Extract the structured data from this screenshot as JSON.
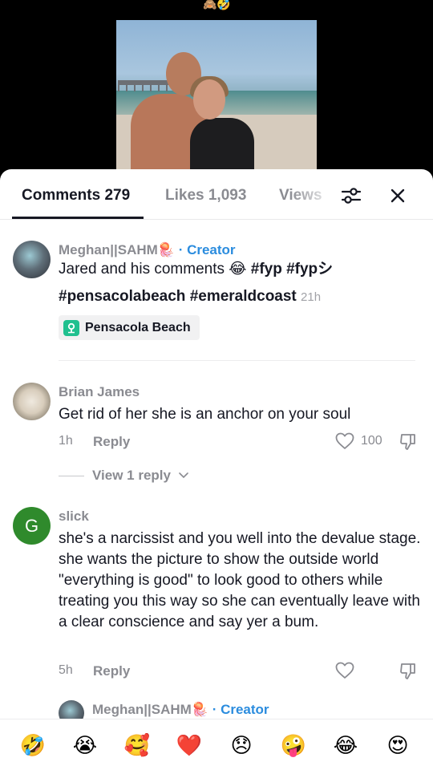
{
  "video": {
    "top_emoji": "🙈🤣"
  },
  "tabs": {
    "comments": "Comments 279",
    "likes": "Likes 1,093",
    "views": "Views"
  },
  "comments": [
    {
      "username": "Meghan||SAHM🪼",
      "creator_label": "· Creator",
      "text_line1": "Jared and his comments 😂",
      "hashtags_line1": "#fyp #fypシ",
      "hashtags_line2": "#pensacolabeach #emeraldcoast",
      "time": "21h",
      "location": "Pensacola Beach"
    },
    {
      "username": "Brian James",
      "text": "Get rid of her she is an anchor on your soul",
      "time": "1h",
      "reply": "Reply",
      "likes": "100",
      "view_replies": "View 1 reply"
    },
    {
      "username": "slick",
      "avatar_letter": "G",
      "text": "she's a narcissist and you well into the devalue stage. she wants the picture to show the outside world \"everything is good\" to look good to others while treating you this way so she can eventually leave with a clear conscience and say yer a bum.",
      "time": "5h",
      "reply": "Reply"
    },
    {
      "username": "Meghan||SAHM🪼",
      "creator_label": "· Creator"
    }
  ],
  "emoji_bar": [
    "🤣",
    "😭",
    "🥰",
    "❤️",
    "😞",
    "🤪",
    "😂",
    "😍"
  ],
  "colors": {
    "accent_creator": "#2b8cde",
    "text_primary": "#161823",
    "text_secondary": "#8a8b91",
    "avatar_g": "#2f8a2c",
    "location_pin": "#20c08f"
  }
}
